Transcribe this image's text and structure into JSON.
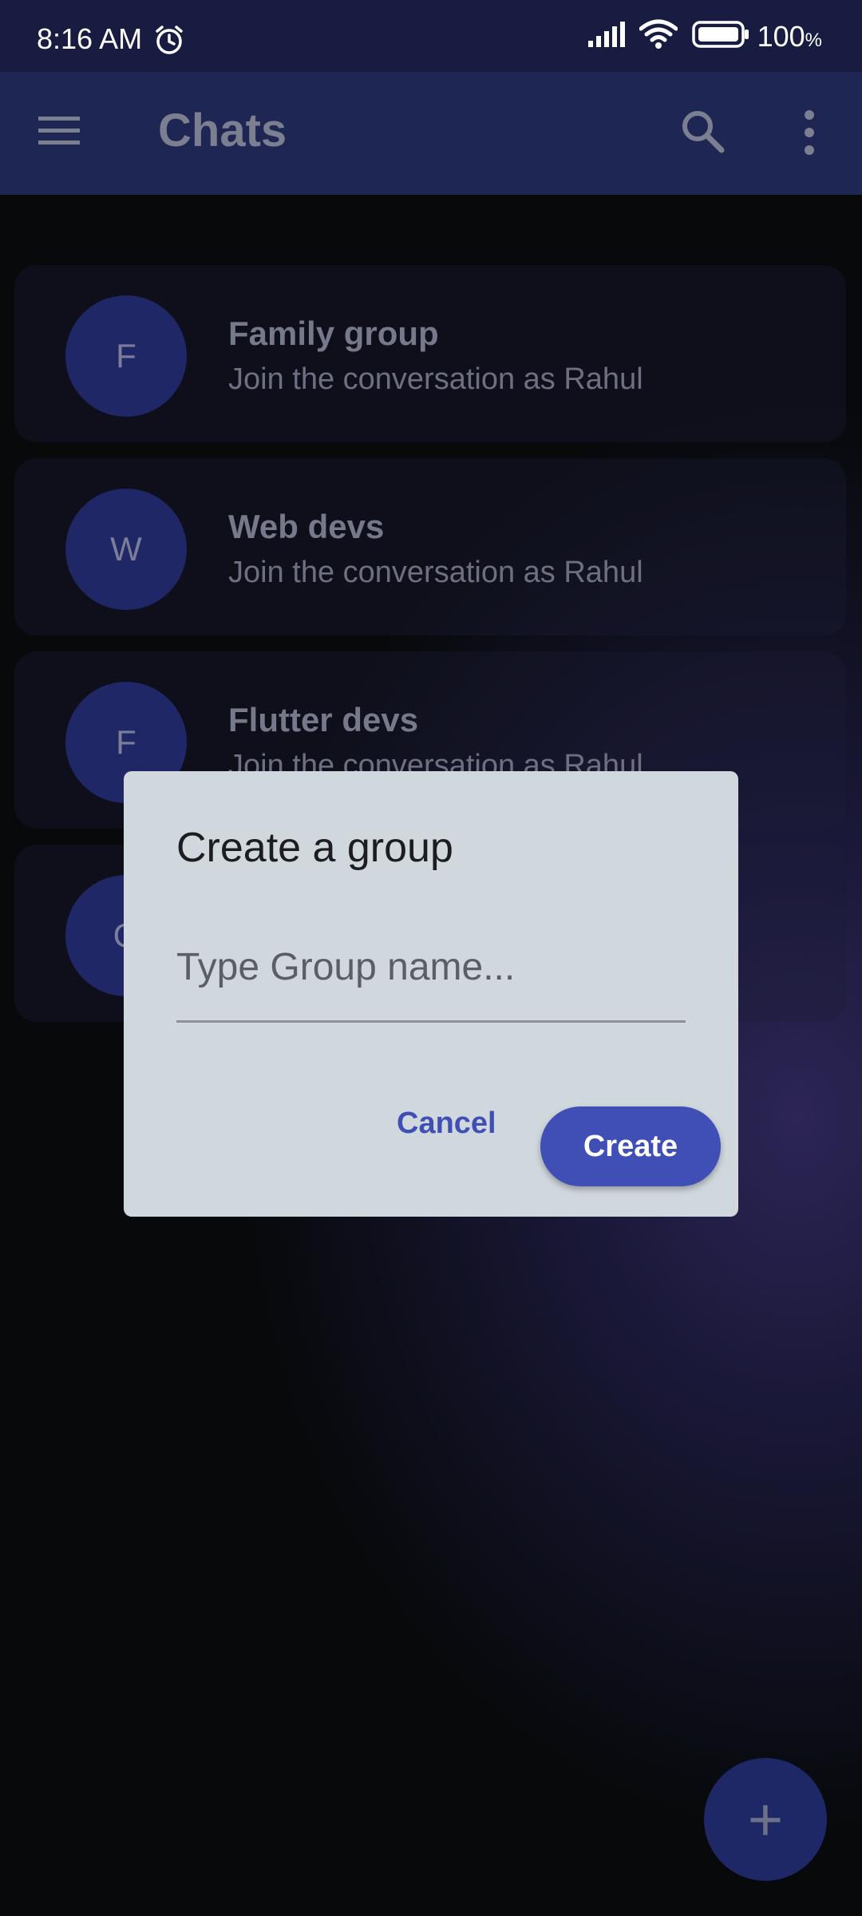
{
  "status_bar": {
    "time": "8:16 AM",
    "battery": "100",
    "battery_unit": "%",
    "icons": [
      "alarm-icon",
      "signal-icon",
      "wifi-icon",
      "battery-icon"
    ]
  },
  "app_bar": {
    "title": "Chats",
    "icons": [
      "menu-icon",
      "search-icon",
      "more-vert-icon"
    ]
  },
  "chats": [
    {
      "initial": "F",
      "name": "Family group",
      "subtitle": "Join the conversation as Rahul"
    },
    {
      "initial": "W",
      "name": "Web devs",
      "subtitle": "Join the conversation as Rahul"
    },
    {
      "initial": "F",
      "name": "Flutter devs",
      "subtitle": "Join the conversation as Rahul"
    },
    {
      "initial": "G",
      "name": "",
      "subtitle": ""
    }
  ],
  "dialog": {
    "title": "Create a group",
    "input_placeholder": "Type Group name...",
    "input_value": "",
    "cancel_label": "Cancel",
    "create_label": "Create"
  },
  "fab": {
    "label": "+",
    "icon": "plus-icon"
  },
  "colors": {
    "status_bar": "#171c40",
    "app_bar": "#1e2654",
    "accent": "#3f4fb5",
    "dialog_bg": "#d0d8de",
    "avatar": "#1f2766"
  }
}
